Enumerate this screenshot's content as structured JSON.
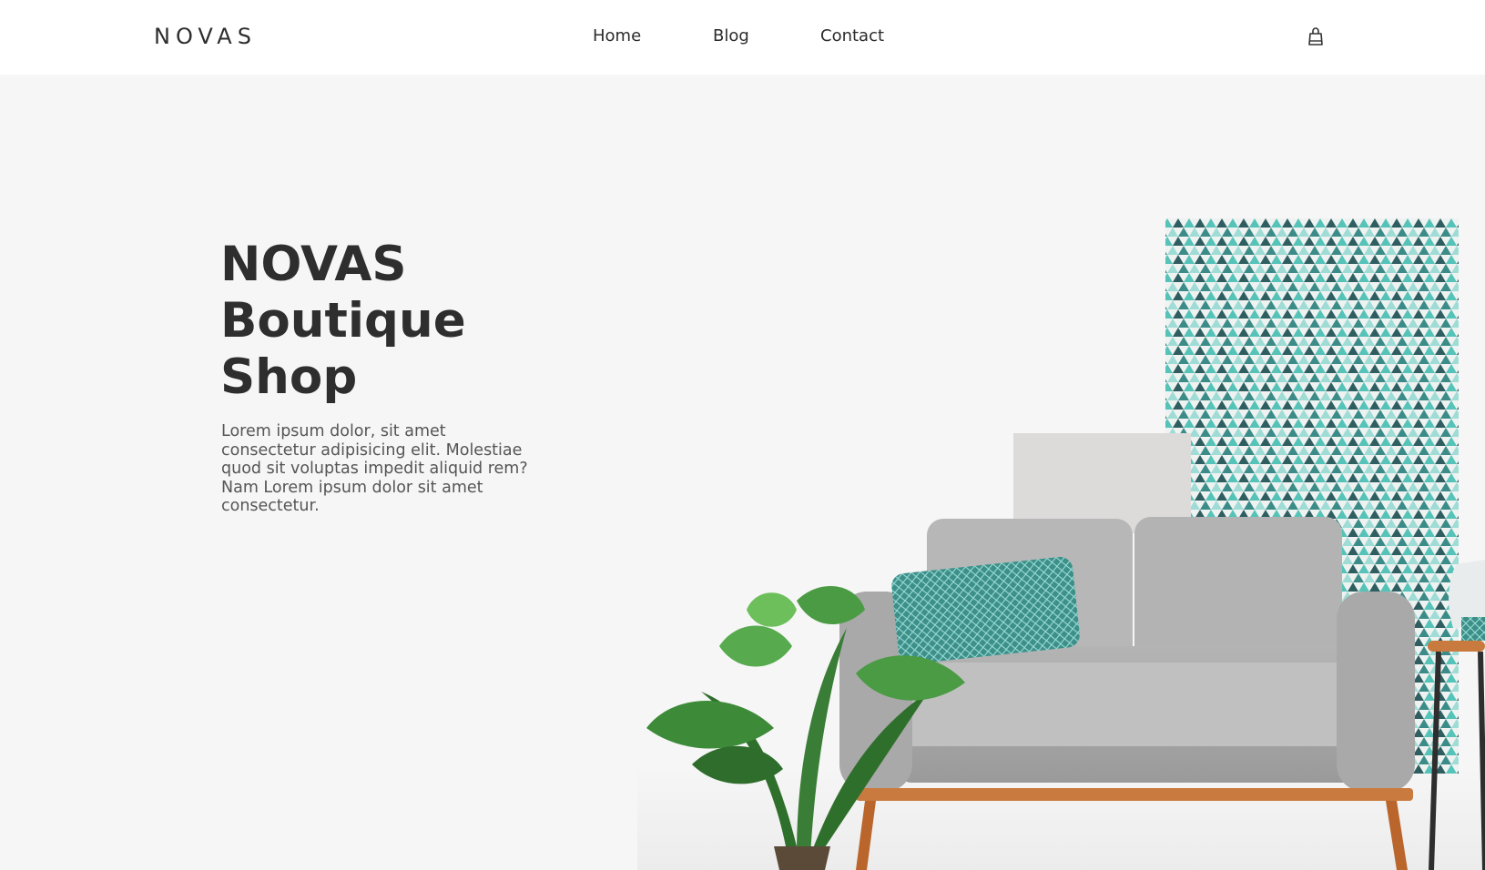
{
  "brand": {
    "logo_text": "NOVAS"
  },
  "nav": {
    "items": [
      {
        "label": "Home"
      },
      {
        "label": "Blog"
      },
      {
        "label": "Contact"
      }
    ]
  },
  "cart": {
    "icon": "shopping-bag-icon"
  },
  "hero": {
    "title_lines": [
      "NOVAS",
      "Boutique",
      "Shop"
    ],
    "description": "Lorem ipsum dolor, sit amet consectetur adipisicing elit. Molestiae quod sit voluptas impedit aliquid rem? Nam Lorem ipsum dolor sit amet consectetur."
  },
  "colors": {
    "header_bg": "#ffffff",
    "page_bg": "#f6f6f6",
    "text_dark": "#2e2e2e",
    "text_muted": "#555555",
    "accent_teal": "#3aa9a0",
    "sofa_gray": "#a8a8a8",
    "wood": "#c97a3e"
  }
}
